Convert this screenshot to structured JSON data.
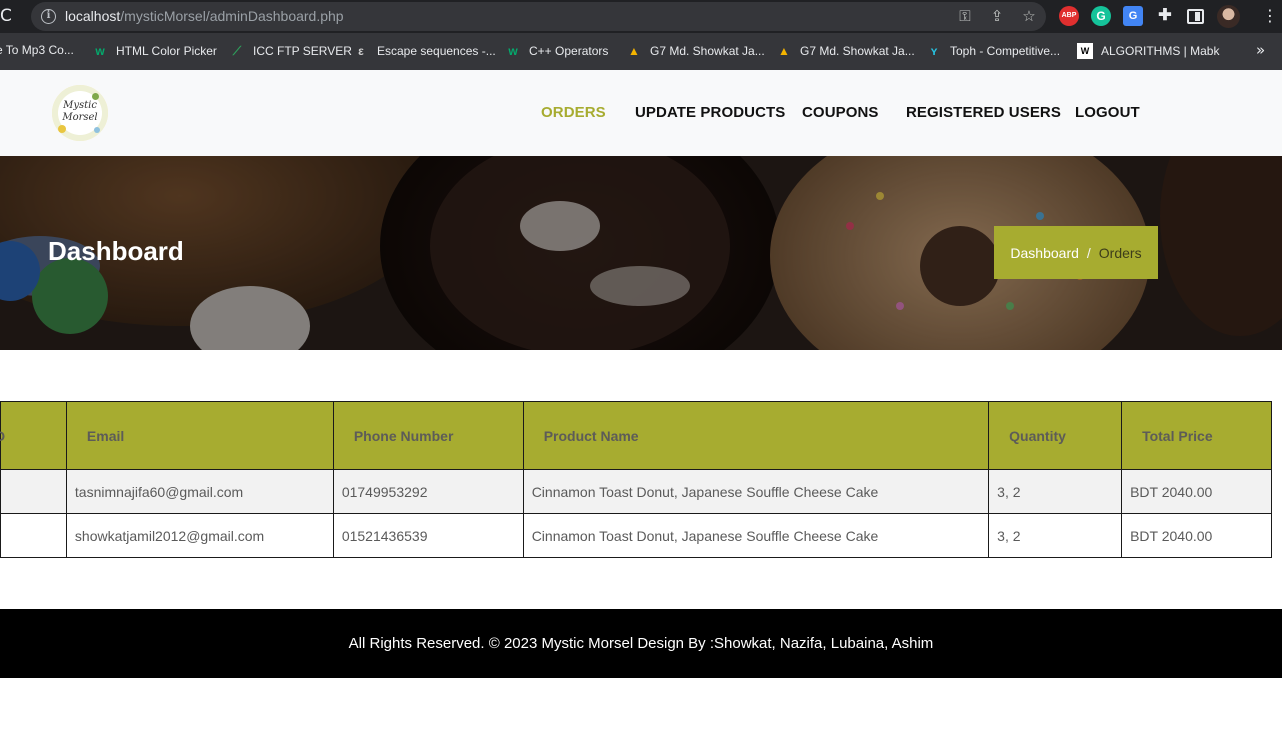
{
  "browser": {
    "url_host": "localhost",
    "url_path": "/mysticMorsel/adminDashboard.php",
    "bookmarks": [
      {
        "label": "e To Mp3 Co...",
        "icon": "none"
      },
      {
        "label": "HTML Color Picker",
        "icon": "w3schools-icon"
      },
      {
        "label": "ICC FTP SERVER",
        "icon": "feather-icon"
      },
      {
        "label": "Escape sequences -...",
        "icon": "cppreference-icon"
      },
      {
        "label": "C++ Operators",
        "icon": "w3schools-icon"
      },
      {
        "label": "G7 Md. Showkat Ja...",
        "icon": "drive-icon"
      },
      {
        "label": "G7 Md. Showkat Ja...",
        "icon": "drive-icon"
      },
      {
        "label": "Toph - Competitive...",
        "icon": "toph-icon"
      },
      {
        "label": "ALGORITHMS | Mabk",
        "icon": "wix-icon"
      }
    ],
    "extensions": {
      "abp": "ABP",
      "grammarly": "G",
      "translate": "G"
    }
  },
  "nav": {
    "brand": "Mystic Morsel",
    "logo_text_1": "Mystic",
    "logo_text_2": "Morsel",
    "links": [
      "ORDERS",
      "UPDATE PRODUCTS",
      "COUPONS",
      "REGISTERED USERS",
      "LOGOUT"
    ],
    "active": "ORDERS"
  },
  "hero": {
    "title": "Dashboard",
    "breadcrumb": {
      "home": "Dashboard",
      "separator": "/",
      "current": "Orders"
    }
  },
  "orders_table": {
    "columns": [
      "D",
      "Email",
      "Phone Number",
      "Product Name",
      "Quantity",
      "Total Price"
    ],
    "rows": [
      {
        "id": "",
        "email": "tasnimnajifa60@gmail.com",
        "phone": "01749953292",
        "product": "Cinnamon Toast Donut, Japanese Souffle Cheese Cake",
        "quantity": "3, 2",
        "total": "BDT 2040.00"
      },
      {
        "id": "",
        "email": "showkatjamil2012@gmail.com",
        "phone": "01521436539",
        "product": "Cinnamon Toast Donut, Japanese Souffle Cheese Cake",
        "quantity": "3, 2",
        "total": "BDT 2040.00"
      }
    ]
  },
  "footer": {
    "text": "All Rights Reserved. © 2023 Mystic Morsel Design By :Showkat, Nazifa, Lubaina, Ashim"
  },
  "colors": {
    "accent": "#a7ac30",
    "footer_bg": "#000000",
    "navbar_bg": "#f8f9fa"
  }
}
